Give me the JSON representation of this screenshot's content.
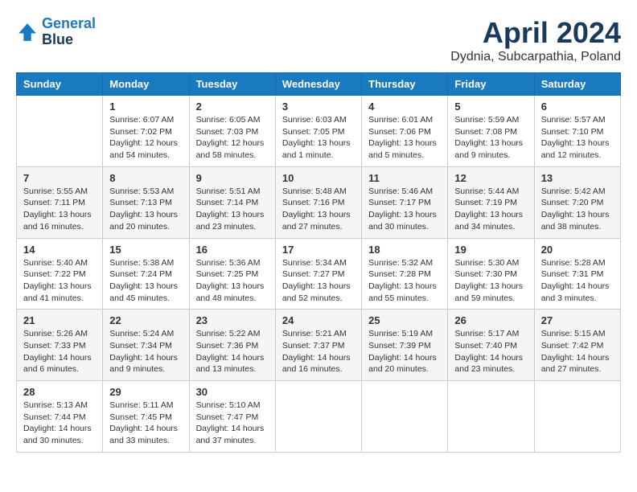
{
  "header": {
    "logo": {
      "line1": "General",
      "line2": "Blue"
    },
    "title": "April 2024",
    "subtitle": "Dydnia, Subcarpathia, Poland"
  },
  "weekdays": [
    "Sunday",
    "Monday",
    "Tuesday",
    "Wednesday",
    "Thursday",
    "Friday",
    "Saturday"
  ],
  "weeks": [
    [
      {
        "day": "",
        "info": ""
      },
      {
        "day": "1",
        "info": "Sunrise: 6:07 AM\nSunset: 7:02 PM\nDaylight: 12 hours\nand 54 minutes."
      },
      {
        "day": "2",
        "info": "Sunrise: 6:05 AM\nSunset: 7:03 PM\nDaylight: 12 hours\nand 58 minutes."
      },
      {
        "day": "3",
        "info": "Sunrise: 6:03 AM\nSunset: 7:05 PM\nDaylight: 13 hours\nand 1 minute."
      },
      {
        "day": "4",
        "info": "Sunrise: 6:01 AM\nSunset: 7:06 PM\nDaylight: 13 hours\nand 5 minutes."
      },
      {
        "day": "5",
        "info": "Sunrise: 5:59 AM\nSunset: 7:08 PM\nDaylight: 13 hours\nand 9 minutes."
      },
      {
        "day": "6",
        "info": "Sunrise: 5:57 AM\nSunset: 7:10 PM\nDaylight: 13 hours\nand 12 minutes."
      }
    ],
    [
      {
        "day": "7",
        "info": "Sunrise: 5:55 AM\nSunset: 7:11 PM\nDaylight: 13 hours\nand 16 minutes."
      },
      {
        "day": "8",
        "info": "Sunrise: 5:53 AM\nSunset: 7:13 PM\nDaylight: 13 hours\nand 20 minutes."
      },
      {
        "day": "9",
        "info": "Sunrise: 5:51 AM\nSunset: 7:14 PM\nDaylight: 13 hours\nand 23 minutes."
      },
      {
        "day": "10",
        "info": "Sunrise: 5:48 AM\nSunset: 7:16 PM\nDaylight: 13 hours\nand 27 minutes."
      },
      {
        "day": "11",
        "info": "Sunrise: 5:46 AM\nSunset: 7:17 PM\nDaylight: 13 hours\nand 30 minutes."
      },
      {
        "day": "12",
        "info": "Sunrise: 5:44 AM\nSunset: 7:19 PM\nDaylight: 13 hours\nand 34 minutes."
      },
      {
        "day": "13",
        "info": "Sunrise: 5:42 AM\nSunset: 7:20 PM\nDaylight: 13 hours\nand 38 minutes."
      }
    ],
    [
      {
        "day": "14",
        "info": "Sunrise: 5:40 AM\nSunset: 7:22 PM\nDaylight: 13 hours\nand 41 minutes."
      },
      {
        "day": "15",
        "info": "Sunrise: 5:38 AM\nSunset: 7:24 PM\nDaylight: 13 hours\nand 45 minutes."
      },
      {
        "day": "16",
        "info": "Sunrise: 5:36 AM\nSunset: 7:25 PM\nDaylight: 13 hours\nand 48 minutes."
      },
      {
        "day": "17",
        "info": "Sunrise: 5:34 AM\nSunset: 7:27 PM\nDaylight: 13 hours\nand 52 minutes."
      },
      {
        "day": "18",
        "info": "Sunrise: 5:32 AM\nSunset: 7:28 PM\nDaylight: 13 hours\nand 55 minutes."
      },
      {
        "day": "19",
        "info": "Sunrise: 5:30 AM\nSunset: 7:30 PM\nDaylight: 13 hours\nand 59 minutes."
      },
      {
        "day": "20",
        "info": "Sunrise: 5:28 AM\nSunset: 7:31 PM\nDaylight: 14 hours\nand 3 minutes."
      }
    ],
    [
      {
        "day": "21",
        "info": "Sunrise: 5:26 AM\nSunset: 7:33 PM\nDaylight: 14 hours\nand 6 minutes."
      },
      {
        "day": "22",
        "info": "Sunrise: 5:24 AM\nSunset: 7:34 PM\nDaylight: 14 hours\nand 9 minutes."
      },
      {
        "day": "23",
        "info": "Sunrise: 5:22 AM\nSunset: 7:36 PM\nDaylight: 14 hours\nand 13 minutes."
      },
      {
        "day": "24",
        "info": "Sunrise: 5:21 AM\nSunset: 7:37 PM\nDaylight: 14 hours\nand 16 minutes."
      },
      {
        "day": "25",
        "info": "Sunrise: 5:19 AM\nSunset: 7:39 PM\nDaylight: 14 hours\nand 20 minutes."
      },
      {
        "day": "26",
        "info": "Sunrise: 5:17 AM\nSunset: 7:40 PM\nDaylight: 14 hours\nand 23 minutes."
      },
      {
        "day": "27",
        "info": "Sunrise: 5:15 AM\nSunset: 7:42 PM\nDaylight: 14 hours\nand 27 minutes."
      }
    ],
    [
      {
        "day": "28",
        "info": "Sunrise: 5:13 AM\nSunset: 7:44 PM\nDaylight: 14 hours\nand 30 minutes."
      },
      {
        "day": "29",
        "info": "Sunrise: 5:11 AM\nSunset: 7:45 PM\nDaylight: 14 hours\nand 33 minutes."
      },
      {
        "day": "30",
        "info": "Sunrise: 5:10 AM\nSunset: 7:47 PM\nDaylight: 14 hours\nand 37 minutes."
      },
      {
        "day": "",
        "info": ""
      },
      {
        "day": "",
        "info": ""
      },
      {
        "day": "",
        "info": ""
      },
      {
        "day": "",
        "info": ""
      }
    ]
  ]
}
